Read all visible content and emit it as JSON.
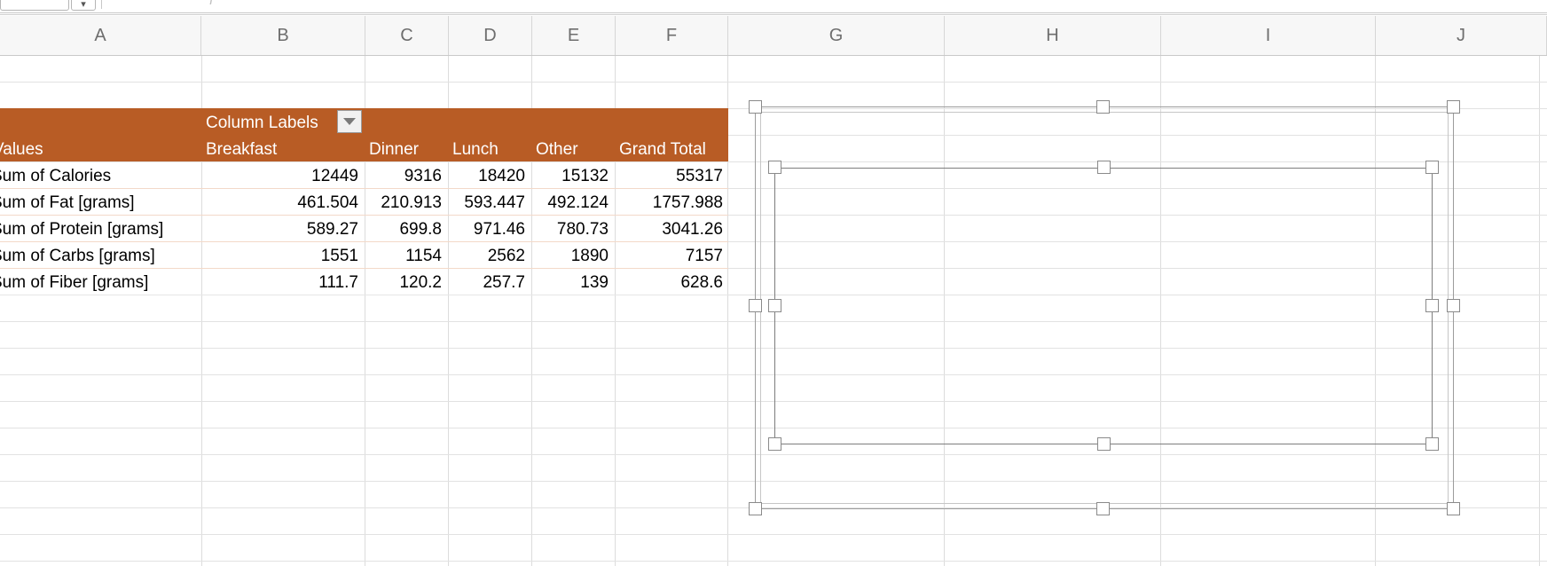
{
  "formula_bar": {
    "namebox_dropdown_glyph": "▾",
    "formula_ghost": "f"
  },
  "columns": [
    "A",
    "B",
    "C",
    "D",
    "E",
    "F",
    "G",
    "H",
    "I",
    "J"
  ],
  "pivot": {
    "column_labels": "Column Labels",
    "values_header": "Values",
    "headers": [
      "Breakfast",
      "Dinner",
      "Lunch",
      "Other",
      "Grand Total"
    ],
    "rows": [
      {
        "label": "Sum of Calories",
        "values": [
          "12449",
          "9316",
          "18420",
          "15132",
          "55317"
        ]
      },
      {
        "label": "Sum of Fat [grams]",
        "values": [
          "461.504",
          "210.913",
          "593.447",
          "492.124",
          "1757.988"
        ]
      },
      {
        "label": "Sum of Protein [grams]",
        "values": [
          "589.27",
          "699.8",
          "971.46",
          "780.73",
          "3041.26"
        ]
      },
      {
        "label": "Sum of Carbs [grams]",
        "values": [
          "1551",
          "1154",
          "2562",
          "1890",
          "7157"
        ]
      },
      {
        "label": "Sum of Fiber [grams]",
        "values": [
          "111.7",
          "120.2",
          "257.7",
          "139",
          "628.6"
        ]
      }
    ],
    "header_color": "#b85c25"
  },
  "chart_object": {
    "state": "selected, empty"
  }
}
